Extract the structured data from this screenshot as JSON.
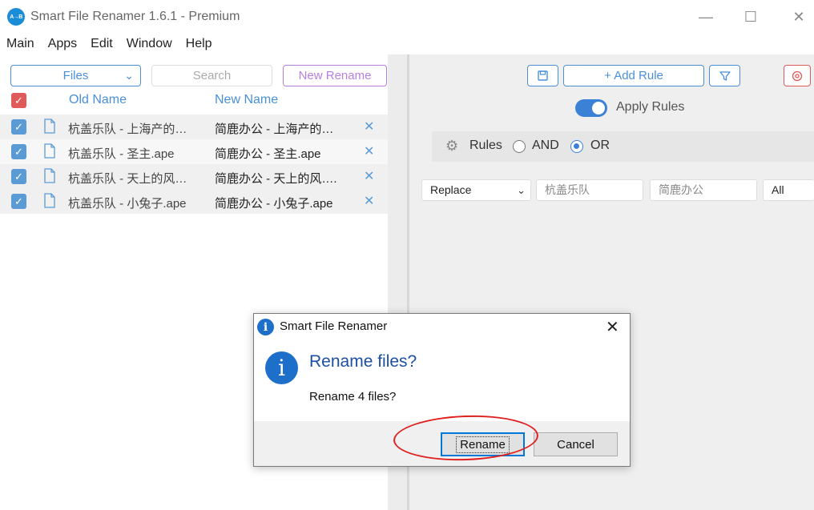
{
  "window": {
    "app_logo_text": "A→B",
    "title": "Smart File Renamer 1.6.1 - Premium",
    "minimize_glyph": "—",
    "maximize_glyph": "☐",
    "close_glyph": "✕"
  },
  "menu": [
    "Main",
    "Apps",
    "Edit",
    "Window",
    "Help"
  ],
  "left": {
    "files_select": "Files",
    "search_placeholder": "Search",
    "new_rename": "New Rename",
    "col_old": "Old Name",
    "col_new": "New Name",
    "rows": [
      {
        "old": "杭盖乐队 - 上海产的…",
        "new": "简鹿办公 - 上海产的…"
      },
      {
        "old": "杭盖乐队 - 圣主.ape",
        "new": "简鹿办公 - 圣主.ape"
      },
      {
        "old": "杭盖乐队 - 天上的风…",
        "new": "简鹿办公 - 天上的风…."
      },
      {
        "old": "杭盖乐队 - 小兔子.ape",
        "new": "简鹿办公 - 小兔子.ape"
      }
    ]
  },
  "right": {
    "add_rule": "+ Add Rule",
    "apply_rules": "Apply Rules",
    "apply_rules_on": true,
    "rules_label": "Rules",
    "and_label": "AND",
    "or_label": "OR",
    "selected_mode": "OR",
    "rule": {
      "type": "Replace",
      "find": "杭盖乐队",
      "replace": "简鹿办公",
      "scope": "All"
    }
  },
  "dialog": {
    "title": "Smart File Renamer",
    "heading": "Rename files?",
    "body": "Rename 4 files?",
    "rename_button": "Rename",
    "cancel_button": "Cancel"
  },
  "colors": {
    "accent": "#4a90d9",
    "purple": "#b67fe0",
    "danger": "#e05a5a",
    "annotation": "#e02020"
  }
}
